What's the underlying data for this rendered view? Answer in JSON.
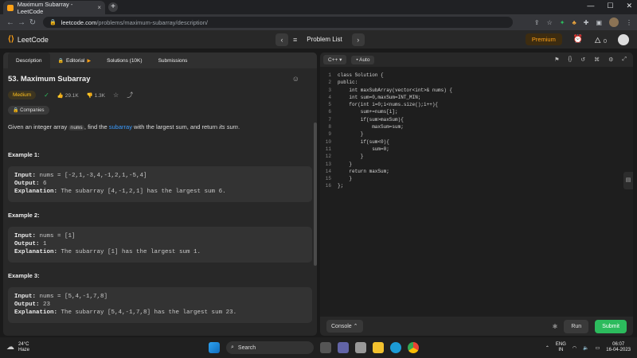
{
  "browser": {
    "tab_title": "Maximum Subarray - LeetCode",
    "tab_close": "×",
    "new_tab": "+",
    "window_controls": {
      "minimize": "—",
      "maximize": "☐",
      "close": "✕"
    },
    "url_domain": "leetcode.com",
    "url_path": "/problems/maximum-subarray/description/"
  },
  "lc_nav": {
    "logo_text": "LeetCode",
    "problem_list": "Problem List",
    "premium": "Premium",
    "streak_count": "0"
  },
  "left_tabs": [
    "Description",
    "Editorial",
    "Solutions (10K)",
    "Submissions"
  ],
  "problem": {
    "title": "53. Maximum Subarray",
    "difficulty": "Medium",
    "likes": "29.1K",
    "dislikes": "1.3K",
    "companies": "Companies",
    "desc_pre": "Given an integer array ",
    "desc_code": "nums",
    "desc_mid": ", find the ",
    "desc_link": "subarray",
    "desc_post": " with the largest sum, and return ",
    "desc_em": "its sum",
    "desc_end": "."
  },
  "examples": [
    {
      "heading": "Example 1:",
      "input": "nums = [-2,1,-3,4,-1,2,1,-5,4]",
      "output": "6",
      "explanation": "The subarray [4,-1,2,1] has the largest sum 6."
    },
    {
      "heading": "Example 2:",
      "input": "nums = [1]",
      "output": "1",
      "explanation": "The subarray [1] has the largest sum 1."
    },
    {
      "heading": "Example 3:",
      "input": "nums = [5,4,-1,7,8]",
      "output": "23",
      "explanation": "The subarray [5,4,-1,7,8] has the largest sum 23."
    }
  ],
  "labels": {
    "input": "Input:",
    "output": "Output:",
    "explanation": "Explanation:"
  },
  "editor": {
    "language": "C++",
    "mode": "Auto",
    "lines": [
      "class Solution {",
      "public:",
      "    int maxSubArray(vector<int>& nums) {",
      "    int sum=0,maxSum=INT_MIN;",
      "    for(int i=0;i<nums.size();i++){",
      "        sum+=nums[i];",
      "        if(sum>maxSum){",
      "            maxSum=sum;",
      "        }",
      "        if(sum<0){",
      "            sum=0;",
      "        }",
      "    }",
      "    return maxSum;",
      "    }",
      "};"
    ],
    "console": "Console",
    "run": "Run",
    "submit": "Submit"
  },
  "taskbar": {
    "temperature": "24°C",
    "weather": "Haze",
    "search": "Search",
    "lang1": "ENG",
    "lang2": "IN",
    "time": "06:07",
    "date": "16-04-2023"
  },
  "colors": {
    "accent": "#ffa116",
    "medium": "#ffc01e",
    "submit": "#2cbb5d",
    "link": "#3b9cff"
  }
}
